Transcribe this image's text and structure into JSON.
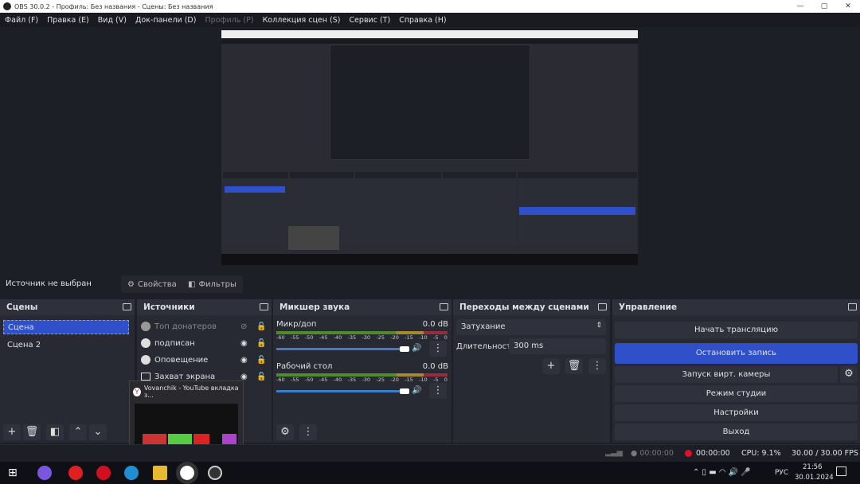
{
  "window": {
    "title": "OBS 30.0.2 - Профиль: Без названия - Сцены: Без названия"
  },
  "menu": [
    {
      "label": "Файл (F)"
    },
    {
      "label": "Правка (E)"
    },
    {
      "label": "Вид (V)"
    },
    {
      "label": "Док-панели (D)"
    },
    {
      "label": "Профиль (P)",
      "disabled": true
    },
    {
      "label": "Коллекция сцен (S)"
    },
    {
      "label": "Сервис (T)"
    },
    {
      "label": "Справка (H)"
    }
  ],
  "source_bar": {
    "status": "Источник не выбран",
    "properties": "Свойства",
    "filters": "Фильтры"
  },
  "scenes": {
    "title": "Сцены",
    "items": [
      "Сцена",
      "Сцена 2"
    ],
    "selected": "Сцена"
  },
  "sources": {
    "title": "Источники",
    "items": [
      {
        "name": "Топ донатеров",
        "visible": false,
        "icon": "globe-icon"
      },
      {
        "name": "подписан",
        "visible": true,
        "icon": "globe-icon"
      },
      {
        "name": "Оповещение",
        "visible": true,
        "icon": "globe-icon"
      },
      {
        "name": "Захват экрана",
        "visible": true,
        "icon": "monitor-icon"
      }
    ]
  },
  "tooltip": {
    "title": "Vovanchik - YouTube вкладка з..."
  },
  "mixer": {
    "title": "Микшер звука",
    "scale": [
      "-60",
      "-55",
      "-50",
      "-45",
      "-40",
      "-35",
      "-30",
      "-25",
      "-20",
      "-15",
      "-10",
      "-5",
      "0"
    ],
    "channels": [
      {
        "name": "Микр/доп",
        "level": "0.0 dB"
      },
      {
        "name": "Рабочий стол",
        "level": "0.0 dB"
      }
    ]
  },
  "transitions": {
    "title": "Переходы между сценами",
    "type": "Затухание",
    "duration_label": "Длительность",
    "duration": "300 ms"
  },
  "controls": {
    "title": "Управление",
    "buttons": [
      "Начать трансляцию",
      "Остановить запись",
      "Запуск вирт. камеры",
      "Режим студии",
      "Настройки",
      "Выход"
    ]
  },
  "status": {
    "stream_time": "00:00:00",
    "rec_time": "00:00:00",
    "cpu": "CPU: 9.1%",
    "fps": "30.00 / 30.00 FPS",
    "rec_color": "#e0102a"
  },
  "taskbar": {
    "lang": "РУС",
    "time": "21:56",
    "date": "30.01.2024"
  },
  "colors": {
    "accent": "#2f50c8",
    "bg": "#1d1f26",
    "dock": "#272a33"
  }
}
